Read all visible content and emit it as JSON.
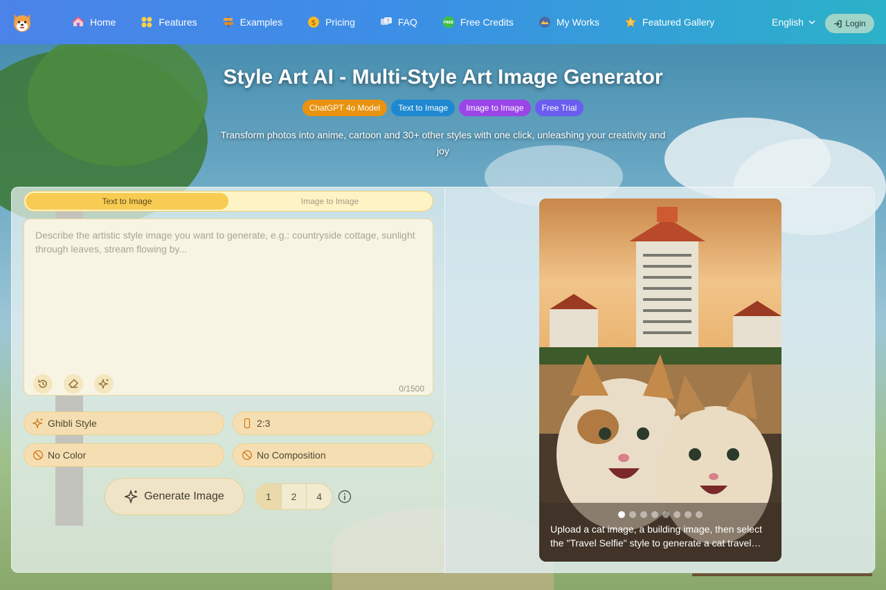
{
  "nav": {
    "items": [
      {
        "label": "Home",
        "icon": "home-icon"
      },
      {
        "label": "Features",
        "icon": "features-icon"
      },
      {
        "label": "Examples",
        "icon": "signpost-icon"
      },
      {
        "label": "Pricing",
        "icon": "coin-icon"
      },
      {
        "label": "FAQ",
        "icon": "faq-icon"
      },
      {
        "label": "Free Credits",
        "icon": "free-icon"
      },
      {
        "label": "My Works",
        "icon": "works-icon"
      },
      {
        "label": "Featured Gallery",
        "icon": "star-icon"
      }
    ],
    "language": "English",
    "login_label": "Login"
  },
  "hero": {
    "title": "Style Art AI - Multi-Style Art Image Generator",
    "badges": [
      "ChatGPT 4o Model",
      "Text to Image",
      "Image to Image",
      "Free Trial"
    ],
    "badge_colors": [
      "#e8920f",
      "#1e88d0",
      "#9a45e8",
      "#6a5ef0"
    ],
    "subtitle": "Transform photos into anime, cartoon and 30+ other styles with one click, unleashing your creativity and joy"
  },
  "generator": {
    "tabs": [
      "Text to Image",
      "Image to Image"
    ],
    "active_tab": "Text to Image",
    "prompt_placeholder": "Describe the artistic style image you want to generate, e.g.: countryside cottage, sunlight through leaves, stream flowing by...",
    "char_counter": "0/1500",
    "options": {
      "style": "Ghibli Style",
      "ratio": "2:3",
      "color": "No Color",
      "composition": "No Composition"
    },
    "generate_label": "Generate Image",
    "counts": [
      "1",
      "2",
      "4"
    ],
    "selected_count": "1"
  },
  "preview": {
    "caption": "Upload a cat image, a building image, then select the \"Travel Selfie\" style to generate a cat travel…",
    "slide_count": 8,
    "active_slide": 1
  },
  "colors": {
    "accent_yellow": "#f8cc52",
    "nav_start": "#4b83e8",
    "nav_end": "#2bb2c8"
  }
}
